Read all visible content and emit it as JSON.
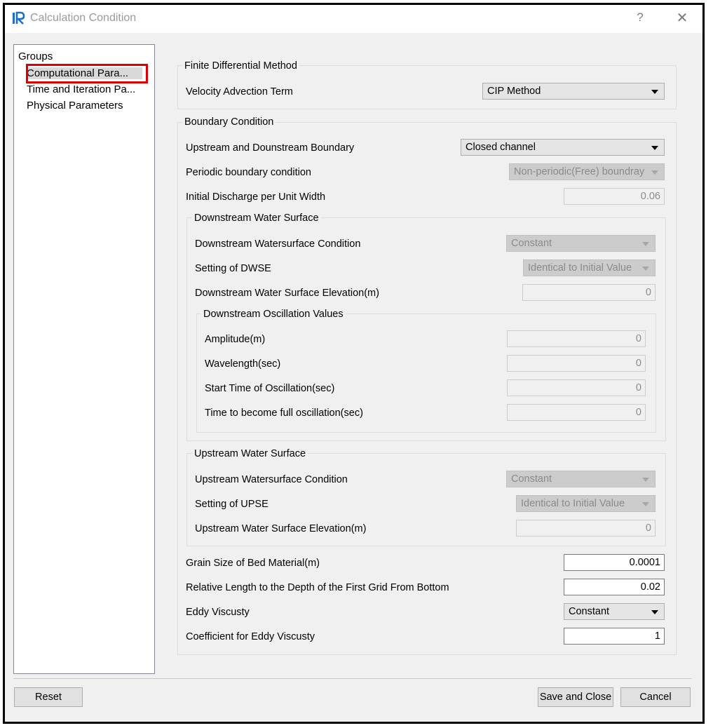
{
  "window": {
    "title": "Calculation Condition",
    "help": "?",
    "close": "✕"
  },
  "groups": {
    "header": "Groups",
    "items": [
      "Computational Para...",
      "Time and Iteration Pa...",
      "Physical Parameters"
    ]
  },
  "fdm": {
    "title": "Finite Differential Method",
    "velocity_label": "Velocity Advection Term",
    "velocity_value": "CIP Method"
  },
  "boundary": {
    "title": "Boundary Condition",
    "updown_label": "Upstream and Dounstream Boundary",
    "updown_value": "Closed channel",
    "periodic_label": "Periodic boundary condition",
    "periodic_value": "Non-periodic(Free) boundray",
    "discharge_label": "Initial Discharge per Unit Width",
    "discharge_value": "0.06"
  },
  "downstream": {
    "title": "Downstream Water Surface",
    "condition_label": "Downstream Watersurface Condition",
    "condition_value": "Constant",
    "dwse_label": "Setting of DWSE",
    "dwse_value": "Identical to Initial Value",
    "elevation_label": "Downstream Water Surface Elevation(m)",
    "elevation_value": "0"
  },
  "oscillation": {
    "title": "Downstream Oscillation Values",
    "amplitude_label": "Amplitude(m)",
    "amplitude_value": "0",
    "wavelength_label": "Wavelength(sec)",
    "wavelength_value": "0",
    "start_label": "Start Time of Oscillation(sec)",
    "start_value": "0",
    "full_label": "Time to become full oscillation(sec)",
    "full_value": "0"
  },
  "upstream": {
    "title": "Upstream Water Surface",
    "condition_label": "Upstream Watersurface Condition",
    "condition_value": "Constant",
    "upse_label": "Setting of UPSE",
    "upse_value": "Identical to Initial Value",
    "elevation_label": "Upstream Water Surface Elevation(m)",
    "elevation_value": "0"
  },
  "bottom": {
    "grain_label": "Grain Size of Bed Material(m)",
    "grain_value": "0.0001",
    "relative_label": "Relative Length to the Depth of the First Grid From Bottom",
    "relative_value": "0.02",
    "eddy_label": "Eddy Viscusty",
    "eddy_value": "Constant",
    "coef_label": "Coefficient for Eddy Viscusty",
    "coef_value": "1"
  },
  "buttons": {
    "reset": "Reset",
    "save_close": "Save and Close",
    "cancel": "Cancel"
  },
  "colors": {
    "highlight": "#e00000",
    "dialog_bg": "#f0f0f0",
    "icon_blue": "#1e6fc8"
  }
}
